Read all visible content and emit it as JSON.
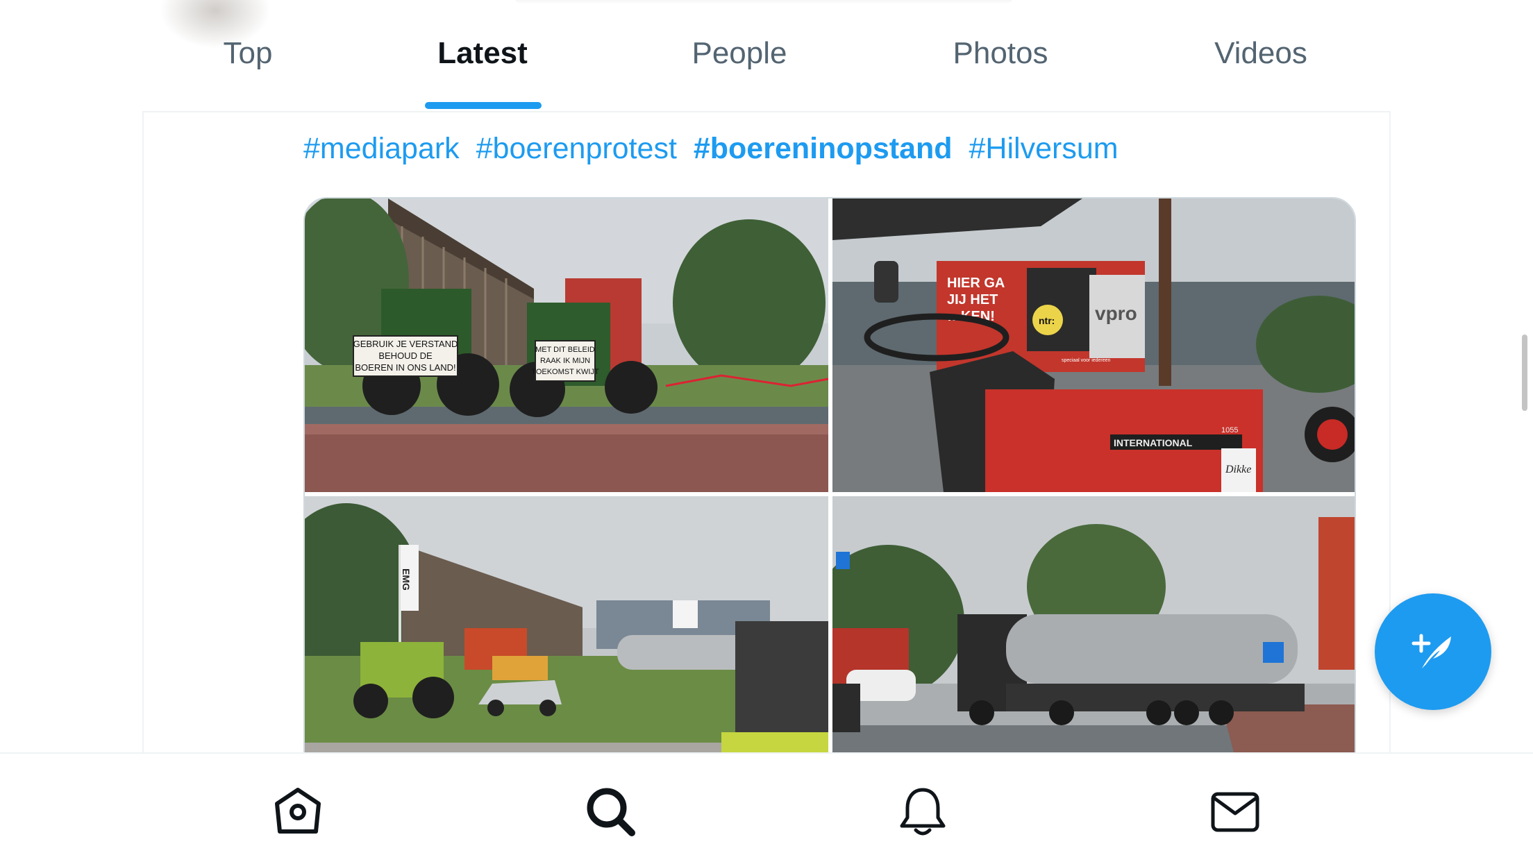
{
  "tabs": [
    {
      "label": "Top",
      "active": false
    },
    {
      "label": "Latest",
      "active": true
    },
    {
      "label": "People",
      "active": false
    },
    {
      "label": "Photos",
      "active": false
    },
    {
      "label": "Videos",
      "active": false
    }
  ],
  "tweet": {
    "hashtags": [
      {
        "text": "#mediapark",
        "bold": false
      },
      {
        "text": "#boerenprotest",
        "bold": false
      },
      {
        "text": "#boereninopstand",
        "bold": true
      },
      {
        "text": "#Hilversum",
        "bold": false
      }
    ],
    "photos": {
      "p1": {
        "sign1_l1": "GEBRUIK JE VERSTAND",
        "sign1_l2": "BEHOUD DE",
        "sign1_l3": "BOEREN IN ONS LAND!",
        "sign2_l1": "MET DIT BELEID",
        "sign2_l2": "RAAK IK MIJN",
        "sign2_l3": "TOEKOMST KWIJT"
      },
      "p2": {
        "billboard_l1": "HIER GA",
        "billboard_l2": "JIJ HET",
        "billboard_l3": "…KEN!",
        "ntr": "ntr:",
        "vpro": "vpro",
        "ntr_sub": "speciaal voor iedereen",
        "brand": "INTERNATIONAL",
        "model": "1055",
        "plate": "Dikke"
      },
      "p3": {
        "flag": "EMG"
      }
    }
  },
  "colors": {
    "accent": "#1d9bf0",
    "text": "#0f1419",
    "muted": "#536471"
  },
  "nav": {
    "icons": [
      "home-icon",
      "search-icon",
      "notifications-icon",
      "messages-icon"
    ],
    "active": "search-icon"
  },
  "fab": {
    "icon": "compose-tweet-icon"
  }
}
